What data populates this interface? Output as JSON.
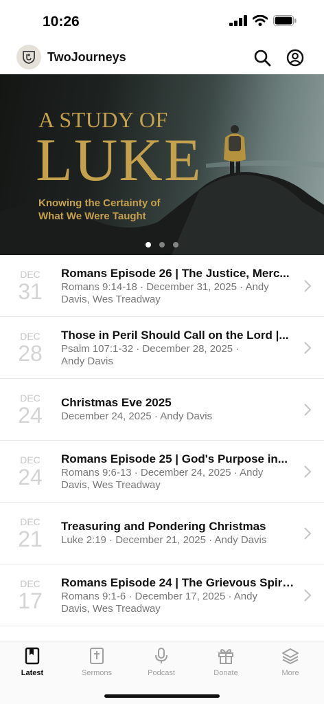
{
  "status": {
    "time": "10:26"
  },
  "header": {
    "app_name": "TwoJourneys",
    "logo_icon": "shield-logo-icon",
    "search_icon": "search-icon",
    "profile_icon": "profile-icon"
  },
  "hero": {
    "title_line1": "A STUDY OF",
    "title_line2": "LUKE",
    "subtitle_line1": "Knowing the Certainty of",
    "subtitle_line2": "What We Were Taught",
    "page_count": 3,
    "active_page": 1,
    "gold_color": "#c5a14e"
  },
  "sermons": [
    {
      "month": "DEC",
      "day": "31",
      "title": "Romans Episode 26 | The Justice, Merc...",
      "subtitle": "Romans 9:14-18 · December 31, 2025 · Andy Davis, Wes Treadway"
    },
    {
      "month": "DEC",
      "day": "28",
      "title": "Those in Peril Should Call on the Lord |...",
      "subtitle": "Psalm 107:1-32 · December 28, 2025 · Andy Davis"
    },
    {
      "month": "DEC",
      "day": "24",
      "title": "Christmas Eve 2025",
      "subtitle": "December 24, 2025 · Andy Davis"
    },
    {
      "month": "DEC",
      "day": "24",
      "title": "Romans Episode 25 | God's Purpose in...",
      "subtitle": "Romans 9:6-13 · December 24, 2025 · Andy Davis, Wes Treadway"
    },
    {
      "month": "DEC",
      "day": "21",
      "title": "Treasuring and Pondering Christmas",
      "subtitle": "Luke 2:19 · December 21, 2025 · Andy Davis"
    },
    {
      "month": "DEC",
      "day": "17",
      "title": "Romans Episode 24 | The Grievous Spiri...",
      "subtitle": "Romans 9:1-6 · December 17, 2025 · Andy Davis, Wes Treadway"
    }
  ],
  "tabs": [
    {
      "label": "Latest",
      "icon": "book-icon",
      "active": true
    },
    {
      "label": "Sermons",
      "icon": "bible-icon",
      "active": false
    },
    {
      "label": "Podcast",
      "icon": "microphone-icon",
      "active": false
    },
    {
      "label": "Donate",
      "icon": "gift-icon",
      "active": false
    },
    {
      "label": "More",
      "icon": "layers-icon",
      "active": false
    }
  ]
}
